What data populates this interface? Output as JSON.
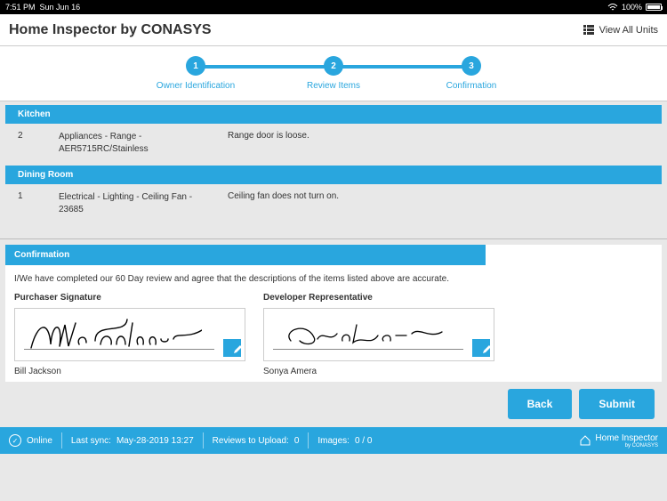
{
  "status_bar": {
    "time": "7:51 PM",
    "date": "Sun Jun 16",
    "battery": "100%"
  },
  "header": {
    "title": "Home Inspector by CONASYS",
    "view_all_label": "View All Units"
  },
  "stepper": {
    "steps": [
      {
        "num": "1",
        "label": "Owner Identification"
      },
      {
        "num": "2",
        "label": "Review Items"
      },
      {
        "num": "3",
        "label": "Confirmation"
      }
    ]
  },
  "review_sections": [
    {
      "title": "Kitchen",
      "items": [
        {
          "num": "2",
          "path": "Appliances - Range - AER5715RC/Stainless",
          "desc": "Range door is loose."
        }
      ]
    },
    {
      "title": "Dining Room",
      "items": [
        {
          "num": "1",
          "path": "Electrical - Lighting - Ceiling Fan - 23685",
          "desc": "Ceiling fan does not turn on."
        }
      ]
    }
  ],
  "confirmation": {
    "header": "Confirmation",
    "statement": "I/We have completed our 60 Day review and agree that the descriptions of the items listed above are accurate.",
    "purchaser_label": "Purchaser Signature",
    "purchaser_name": "Bill Jackson",
    "developer_label": "Developer Representative",
    "developer_name": "Sonya Amera"
  },
  "buttons": {
    "back": "Back",
    "submit": "Submit"
  },
  "footer": {
    "online": "Online",
    "last_sync_label": "Last sync:",
    "last_sync_value": "May-28-2019 13:27",
    "reviews_label": "Reviews to Upload:",
    "reviews_value": "0",
    "images_label": "Images:",
    "images_value": "0 / 0",
    "brand_main": "Home Inspector",
    "brand_sub": "by CONASYS"
  }
}
